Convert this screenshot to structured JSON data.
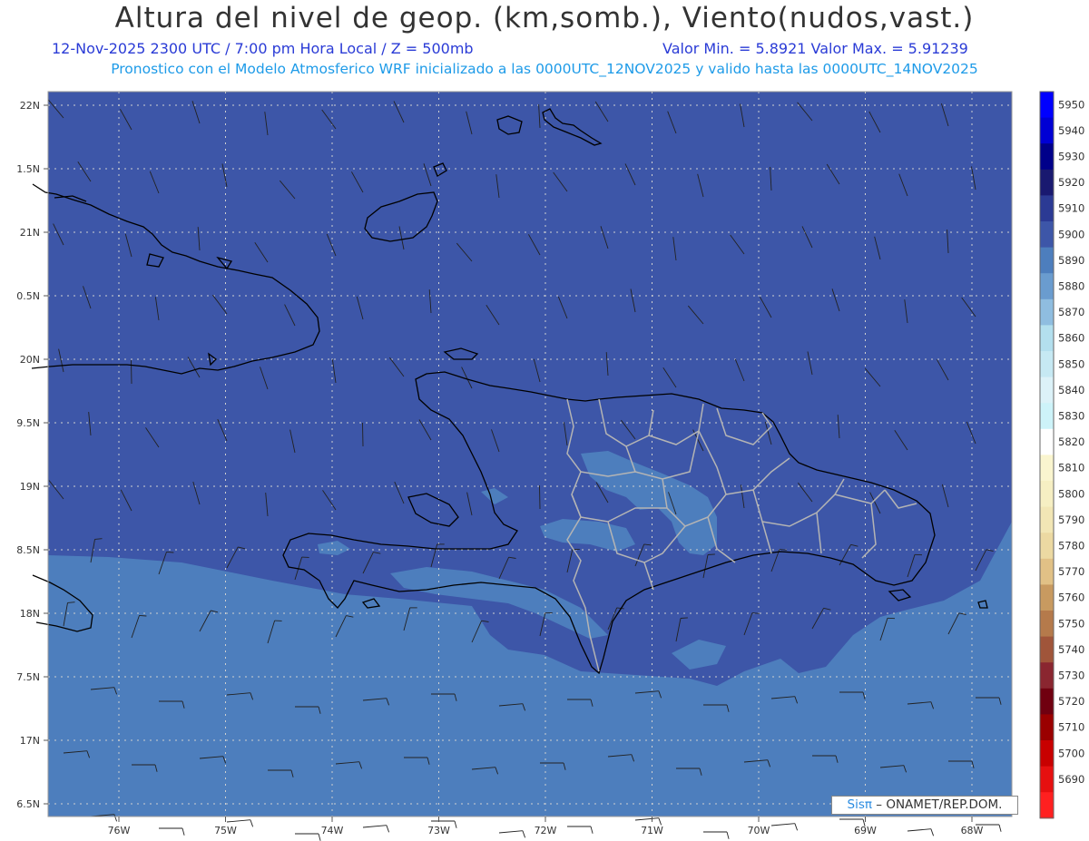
{
  "header": {
    "title": "Altura del nivel de geop. (km,somb.), Viento(nudos,vast.)",
    "subtitle_left": "12-Nov-2025  2300 UTC / 7:00 pm Hora Local / Z = 500mb",
    "subtitle_right": "Valor Min. = 5.8921  Valor Max. = 5.91239",
    "info": "Pronostico con el Modelo Atmosferico WRF inicializado a las 0000UTC_12NOV2025 y valido hasta las  0000UTC_14NOV2025"
  },
  "map": {
    "lat_labels": [
      "22N",
      "1.5N",
      "21N",
      "0.5N",
      "20N",
      "9.5N",
      "19N",
      "8.5N",
      "18N",
      "7.5N",
      "17N",
      "6.5N"
    ],
    "lon_labels": [
      "76W",
      "75W",
      "74W",
      "73W",
      "72W",
      "71W",
      "70W",
      "69W",
      "68W"
    ],
    "colors": {
      "region_5900": "#3d56a8",
      "region_5890": "#4d7ebd",
      "region_5880": "#6a9ccf",
      "coastline": "#000000",
      "borders": "#b4b4b4",
      "grid": "#d0d0d0"
    }
  },
  "colorbar": {
    "levels": [
      {
        "label": "5950",
        "color": "#0000ff"
      },
      {
        "label": "5940",
        "color": "#0000d4"
      },
      {
        "label": "5930",
        "color": "#00008a"
      },
      {
        "label": "5920",
        "color": "#191970"
      },
      {
        "label": "5910",
        "color": "#2b3a94"
      },
      {
        "label": "5900",
        "color": "#3d56a8"
      },
      {
        "label": "5890",
        "color": "#4d7ebd"
      },
      {
        "label": "5880",
        "color": "#6a9ccf"
      },
      {
        "label": "5870",
        "color": "#8fbde0"
      },
      {
        "label": "5860",
        "color": "#b3dfee"
      },
      {
        "label": "5850",
        "color": "#c6e9f3"
      },
      {
        "label": "5840",
        "color": "#dcf2f8"
      },
      {
        "label": "5830",
        "color": "#cdf3f9"
      },
      {
        "label": "5820",
        "color": "#ffffff"
      },
      {
        "label": "5810",
        "color": "#faf5cf"
      },
      {
        "label": "5800",
        "color": "#f6efc3"
      },
      {
        "label": "5790",
        "color": "#f2e6b5"
      },
      {
        "label": "5780",
        "color": "#ecd9a2"
      },
      {
        "label": "5770",
        "color": "#e1c186"
      },
      {
        "label": "5760",
        "color": "#c89a60"
      },
      {
        "label": "5750",
        "color": "#b57a4b"
      },
      {
        "label": "5740",
        "color": "#a0553a"
      },
      {
        "label": "5730",
        "color": "#8a2630"
      },
      {
        "label": "5720",
        "color": "#700010"
      },
      {
        "label": "5710",
        "color": "#9a0000"
      },
      {
        "label": "5700",
        "color": "#c80000"
      },
      {
        "label": "5690",
        "color": "#e61010"
      },
      {
        "label": "",
        "color": "#ff2020"
      }
    ]
  },
  "credit": {
    "sis": "Sisπ",
    "rest": " – ONAMET/REP.DOM."
  }
}
